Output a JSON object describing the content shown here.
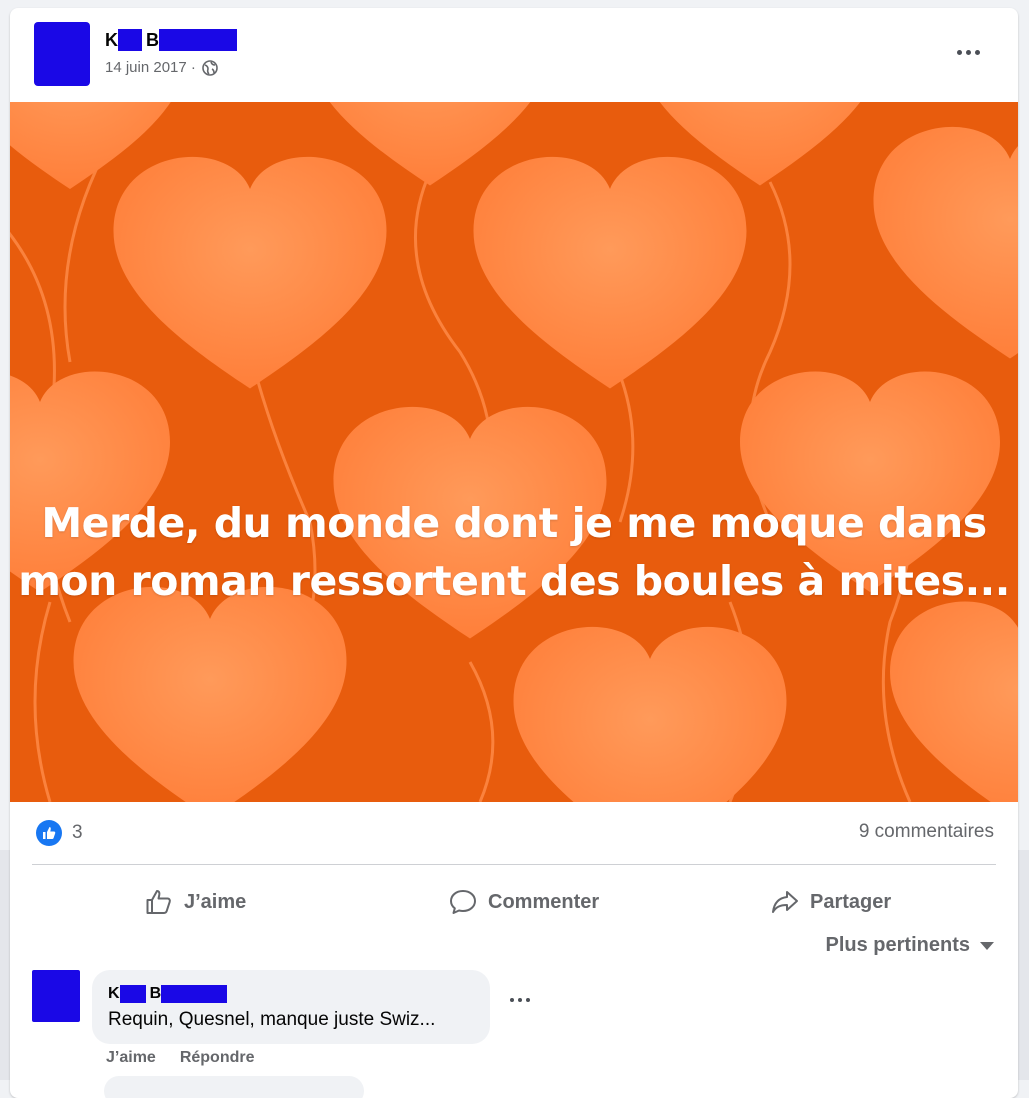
{
  "post": {
    "author_initial_1": "K",
    "author_initial_2": "B",
    "date": "14 juin 2017 ·",
    "text_line_1": "Merde, du monde dont je me moque dans",
    "text_line_2": "mon roman ressortent des boules à mites...",
    "background_color": "#e85c0d",
    "heart_color": "#ff8a45"
  },
  "stats": {
    "reaction_count": "3",
    "comments": "9 commentaires"
  },
  "actions": {
    "like": "J’aime",
    "comment": "Commenter",
    "share": "Partager"
  },
  "sort": {
    "label": "Plus pertinents"
  },
  "comment": {
    "author_initial_1": "K",
    "author_initial_2": "B",
    "text": "Requin, Quesnel, manque juste Swiz...",
    "like": "J’aime",
    "reply": "Répondre"
  },
  "icons": {
    "more": "more-horizontal-icon",
    "globe": "globe-icon",
    "like": "thumbs-up-icon",
    "comment": "comment-icon",
    "share": "share-icon"
  }
}
